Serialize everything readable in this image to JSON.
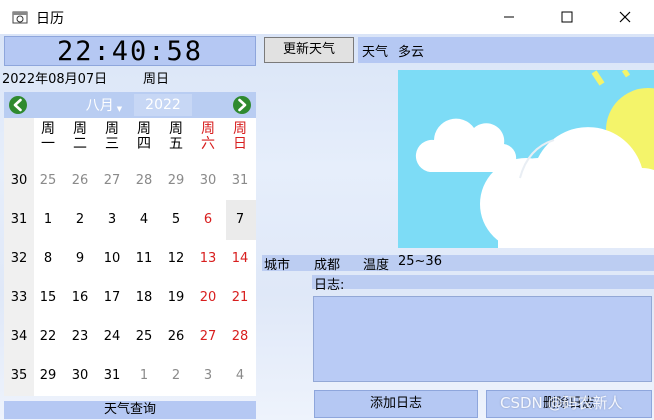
{
  "window": {
    "title": "日历"
  },
  "clock": {
    "time": "22:40:58"
  },
  "date": {
    "text": "2022年08月07日",
    "weekday": "周日"
  },
  "calendar": {
    "month": "八月",
    "year": "2022",
    "dow": [
      {
        "l1": "周",
        "l2": "一",
        "red": false
      },
      {
        "l1": "周",
        "l2": "二",
        "red": false
      },
      {
        "l1": "周",
        "l2": "三",
        "red": false
      },
      {
        "l1": "周",
        "l2": "四",
        "red": false
      },
      {
        "l1": "周",
        "l2": "五",
        "red": false
      },
      {
        "l1": "周",
        "l2": "六",
        "red": true
      },
      {
        "l1": "周",
        "l2": "日",
        "red": true
      }
    ],
    "weeks": [
      {
        "wk": "30",
        "days": [
          {
            "d": "25",
            "m": true
          },
          {
            "d": "26",
            "m": true
          },
          {
            "d": "27",
            "m": true
          },
          {
            "d": "28",
            "m": true
          },
          {
            "d": "29",
            "m": true
          },
          {
            "d": "30",
            "m": true
          },
          {
            "d": "31",
            "m": true
          }
        ]
      },
      {
        "wk": "31",
        "days": [
          {
            "d": "1"
          },
          {
            "d": "2"
          },
          {
            "d": "3"
          },
          {
            "d": "4"
          },
          {
            "d": "5"
          },
          {
            "d": "6",
            "r": true
          },
          {
            "d": "7"
          }
        ]
      },
      {
        "wk": "32",
        "days": [
          {
            "d": "8"
          },
          {
            "d": "9"
          },
          {
            "d": "10"
          },
          {
            "d": "11"
          },
          {
            "d": "12"
          },
          {
            "d": "13",
            "r": true
          },
          {
            "d": "14",
            "r": true
          }
        ]
      },
      {
        "wk": "33",
        "days": [
          {
            "d": "15"
          },
          {
            "d": "16"
          },
          {
            "d": "17"
          },
          {
            "d": "18"
          },
          {
            "d": "19"
          },
          {
            "d": "20",
            "r": true
          },
          {
            "d": "21",
            "r": true
          }
        ]
      },
      {
        "wk": "34",
        "days": [
          {
            "d": "22"
          },
          {
            "d": "23"
          },
          {
            "d": "24"
          },
          {
            "d": "25"
          },
          {
            "d": "26"
          },
          {
            "d": "27",
            "r": true
          },
          {
            "d": "28",
            "r": true
          }
        ]
      },
      {
        "wk": "35",
        "days": [
          {
            "d": "29"
          },
          {
            "d": "30"
          },
          {
            "d": "31"
          },
          {
            "d": "1",
            "m": true
          },
          {
            "d": "2",
            "m": true
          },
          {
            "d": "3",
            "m": true
          },
          {
            "d": "4",
            "m": true
          }
        ]
      }
    ],
    "footer": "天气查询"
  },
  "weather": {
    "update_label": "更新天气",
    "label": "天气",
    "value": "多云",
    "city_label": "城市",
    "city": "成都",
    "temp_label": "温度",
    "temp": "25~36",
    "icon": "partly-cloudy-icon"
  },
  "log": {
    "label": "日志:"
  },
  "actions": {
    "add_label": "添加日志",
    "delete_label": "删除日志"
  },
  "watermark": "CSDN @码农新人",
  "colors": {
    "weekend": "#d81e1e",
    "panel": "#b5c8f3",
    "weather_bg": "#7ddcf6"
  }
}
